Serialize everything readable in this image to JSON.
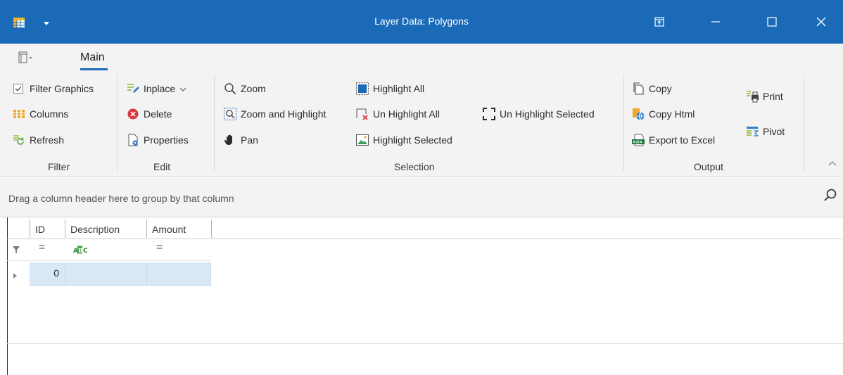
{
  "window": {
    "title": "Layer Data: Polygons",
    "titlebar_color": "#1a6ab7"
  },
  "ribbon": {
    "tabs": [
      {
        "label": "Main",
        "active": true
      }
    ],
    "groups": {
      "filter": {
        "label": "Filter",
        "items": [
          "Filter Graphics",
          "Columns",
          "Refresh"
        ]
      },
      "edit": {
        "label": "Edit",
        "items": [
          "Inplace",
          "Delete",
          "Properties"
        ]
      },
      "selection": {
        "label": "Selection",
        "items": [
          "Zoom",
          "Zoom and Highlight",
          "Pan",
          "Highlight All",
          "Un Highlight All",
          "Highlight Selected",
          "Un Highlight Selected"
        ]
      },
      "output": {
        "label": "Output",
        "items": [
          "Copy",
          "Copy Html",
          "Export to Excel",
          "Print",
          "Pivot"
        ]
      }
    }
  },
  "grid": {
    "group_hint": "Drag a column header here to group by that column",
    "columns": [
      "ID",
      "Description",
      "Amount"
    ],
    "filter_row": [
      "=",
      "ABC",
      "="
    ],
    "rows": [
      {
        "id": "0",
        "description": "",
        "amount": ""
      }
    ],
    "selected_row_color": "#d8e8f6"
  },
  "icons": {
    "app": "table-app-icon",
    "quick_access": "dropdown-arrow-icon",
    "restore_layout": "pin-window-icon",
    "minimize": "minimize-icon",
    "maximize": "maximize-icon",
    "close": "close-icon",
    "search": "search-icon"
  }
}
